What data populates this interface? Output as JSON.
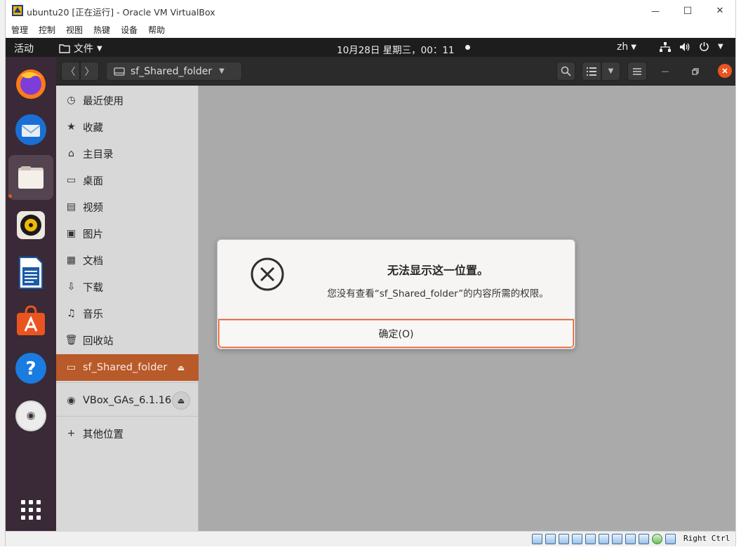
{
  "host": {
    "title": "ubuntu20 [正在运行] - Oracle VM VirtualBox",
    "menu": [
      "管理",
      "控制",
      "视图",
      "热键",
      "设备",
      "帮助"
    ],
    "host_key": "Right Ctrl",
    "controls": {
      "minimize": "—",
      "maximize": "☐",
      "close": "✕"
    }
  },
  "topbar": {
    "activities": "活动",
    "app_menu": "文件",
    "clock": "10月28日 星期三，00：11",
    "input_method": "zh"
  },
  "dock": {
    "items": [
      "firefox-icon",
      "thunderbird-icon",
      "files-icon",
      "rhythmbox-icon",
      "libreoffice-writer-icon",
      "software-icon",
      "help-icon",
      "dvd-icon",
      "show-apps-icon"
    ]
  },
  "headerbar": {
    "path": "sf_Shared_folder"
  },
  "sidebar": {
    "items": [
      {
        "label": "最近使用",
        "icon": "clock-icon"
      },
      {
        "label": "收藏",
        "icon": "star-icon"
      },
      {
        "label": "主目录",
        "icon": "home-icon"
      },
      {
        "label": "桌面",
        "icon": "desktop-icon"
      },
      {
        "label": "视频",
        "icon": "video-icon"
      },
      {
        "label": "图片",
        "icon": "picture-icon"
      },
      {
        "label": "文档",
        "icon": "document-icon"
      },
      {
        "label": "下载",
        "icon": "download-icon"
      },
      {
        "label": "音乐",
        "icon": "music-icon"
      },
      {
        "label": "回收站",
        "icon": "trash-icon"
      }
    ],
    "devices": [
      {
        "label": "sf_Shared_folder",
        "icon": "drive-icon",
        "selected": true
      },
      {
        "label": "VBox_GAs_6.1.16",
        "icon": "disc-icon",
        "selected": false
      }
    ],
    "other": "其他位置"
  },
  "dialog": {
    "title": "无法显示这一位置。",
    "message": "您没有查看“sf_Shared_folder”的内容所需的权限。",
    "ok_label": "确定(O)"
  },
  "colors": {
    "ubuntu_orange": "#e95420",
    "selected_sidebar": "#b85a2a",
    "dock_bg": "#3a2936"
  }
}
